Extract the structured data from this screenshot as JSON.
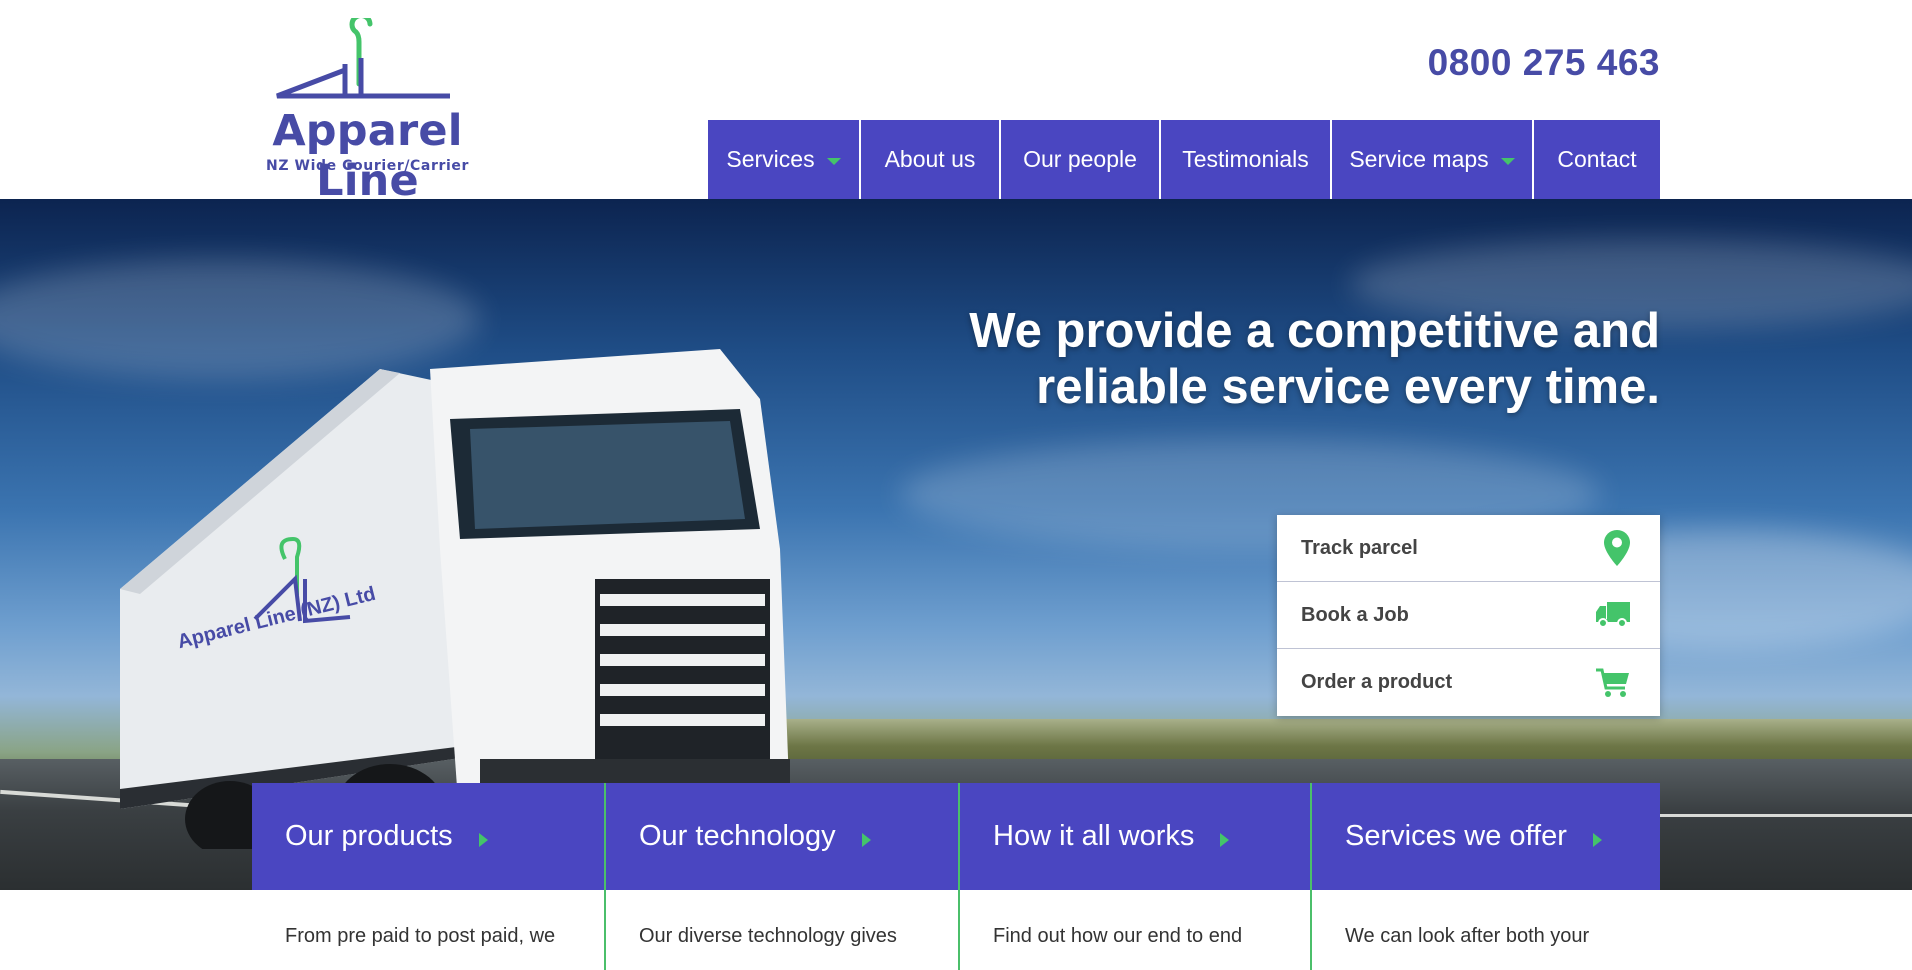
{
  "header": {
    "logo": {
      "title": "Apparel Line",
      "tagline": "NZ Wide Courier/Carrier"
    },
    "phone": "0800 275 463",
    "nav": [
      {
        "label": "Services",
        "dropdown": true
      },
      {
        "label": "About us",
        "dropdown": false
      },
      {
        "label": "Our people",
        "dropdown": false
      },
      {
        "label": "Testimonials",
        "dropdown": false
      },
      {
        "label": "Service maps",
        "dropdown": true
      },
      {
        "label": "Contact",
        "dropdown": false
      }
    ]
  },
  "hero": {
    "headline_line1": "We provide a competitive and",
    "headline_line2": "reliable service every time.",
    "truck_text": "Apparel Line (NZ) Ltd",
    "quick_links": [
      {
        "label": "Track parcel",
        "icon": "map-pin-icon"
      },
      {
        "label": "Book a Job",
        "icon": "truck-icon"
      },
      {
        "label": "Order a product",
        "icon": "shopping-cart-icon"
      }
    ]
  },
  "features": [
    {
      "title": "Our products",
      "text": "From pre paid to post paid, we"
    },
    {
      "title": "Our technology",
      "text": "Our diverse technology gives"
    },
    {
      "title": "How it all works",
      "text": "Find out how our end to end"
    },
    {
      "title": "Services we offer",
      "text": "We can look after both your"
    }
  ],
  "colors": {
    "brand": "#4a46c1",
    "brand_dark": "#474ba6",
    "accent_green": "#44c46a"
  }
}
